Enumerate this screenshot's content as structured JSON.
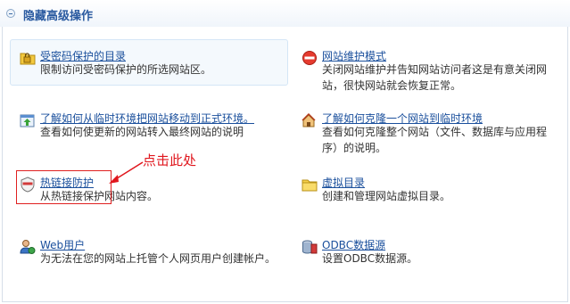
{
  "header": {
    "title": "隐藏高级操作"
  },
  "items": [
    {
      "title": "受密码保护的目录",
      "desc": "限制访问受密码保护的所选网站区。"
    },
    {
      "title": "网站维护模式",
      "desc": "关闭网站维护并告知网站访问者这是有意关闭网站，很快网站就会恢复正常。"
    },
    {
      "title": "了解如何从临时环境把网站移动到正式环境。",
      "desc": "查看如何使更新的网站转入最终网站的说明"
    },
    {
      "title": "了解如何克隆一个网站到临时环境",
      "desc": "查看如何克隆整个网站（文件、数据库与应用程序）的说明。"
    },
    {
      "title": "热链接防护",
      "desc": "从热链接保护网站内容。"
    },
    {
      "title": "虚拟目录",
      "desc": "创建和管理网站虚拟目录。"
    },
    {
      "title": "Web用户",
      "desc": "为无法在您的网站上托管个人网页用户创建帐户。"
    },
    {
      "title": "ODBC数据源",
      "desc": "设置ODBC数据源。"
    }
  ],
  "annotation": {
    "text": "点击此处",
    "color": "#e0161d"
  },
  "icons": [
    "lock-folder-icon",
    "no-entry-icon",
    "upload-site-icon",
    "clone-site-icon",
    "hotlink-shield-icon",
    "folder-icon",
    "web-user-icon",
    "database-icon"
  ]
}
